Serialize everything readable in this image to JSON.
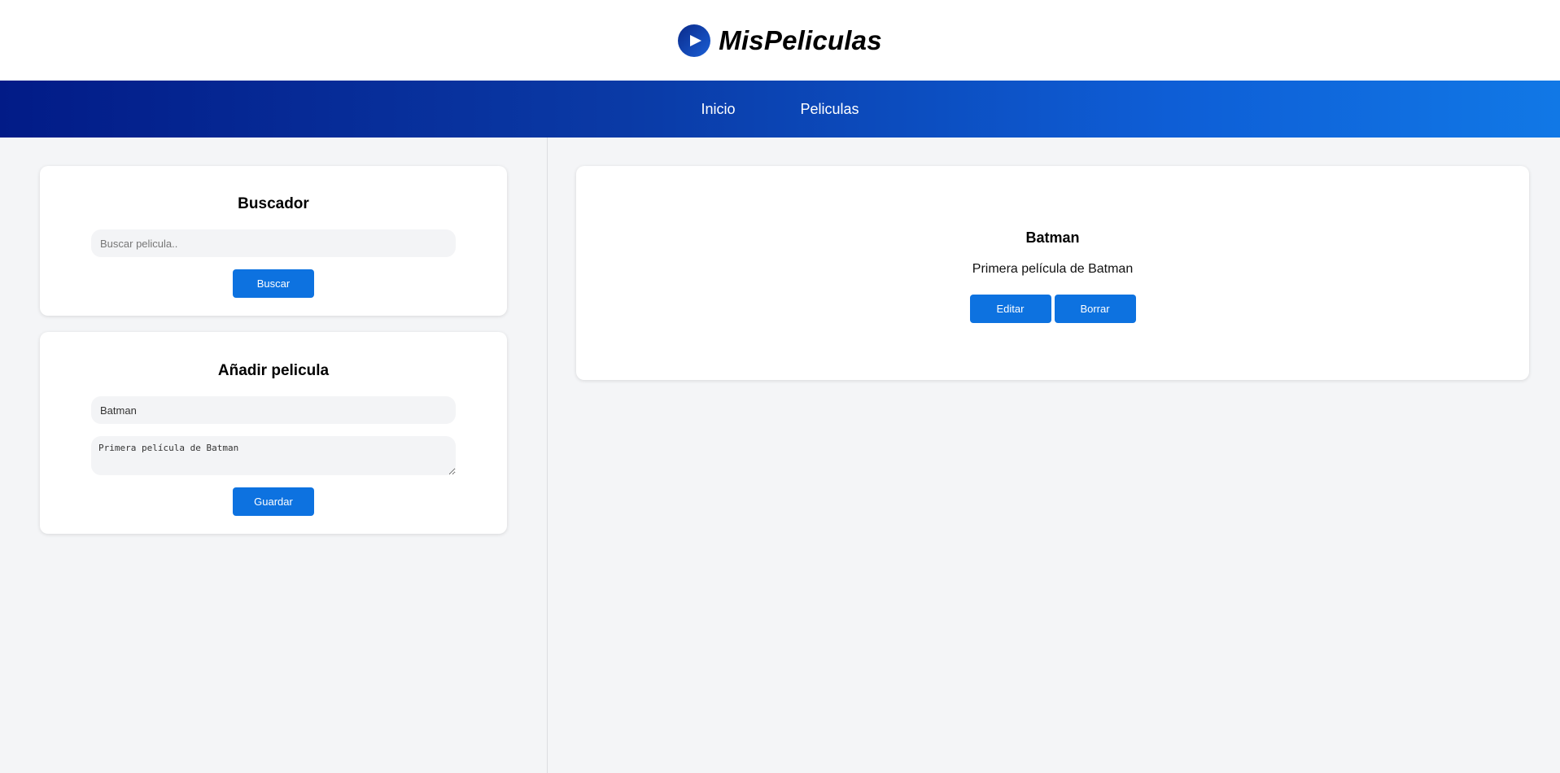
{
  "header": {
    "logo_text": "MisPeliculas",
    "logo_icon": "play-icon"
  },
  "nav": {
    "items": [
      {
        "label": "Inicio"
      },
      {
        "label": "Peliculas"
      }
    ]
  },
  "search": {
    "title": "Buscador",
    "placeholder": "Buscar pelicula..",
    "button": "Buscar"
  },
  "add_movie": {
    "title": "Añadir pelicula",
    "title_value": "Batman",
    "description_value": "Primera película de Batman",
    "button": "Guardar"
  },
  "movies": [
    {
      "title": "Batman",
      "description": "Primera película de Batman",
      "edit_label": "Editar",
      "delete_label": "Borrar"
    }
  ],
  "colors": {
    "accent": "#0d72e0",
    "nav_start": "#021b87",
    "nav_end": "#1178e6"
  }
}
